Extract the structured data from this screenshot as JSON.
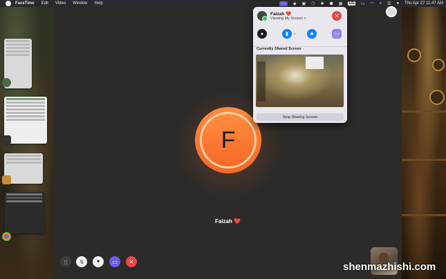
{
  "menubar": {
    "apple": "",
    "items": [
      "FaceTime",
      "Edit",
      "Video",
      "Window",
      "Help"
    ],
    "status_badge": "US",
    "clock": "Thu Apr 27  11:47 AM"
  },
  "call": {
    "avatar_initial": "F",
    "caller_name": "Faizah ❤️"
  },
  "popover": {
    "name": "Faizah ❤️",
    "subtitle": "Viewing My Screen >",
    "shared_label": "Currently Shared Screen",
    "stop_label": "Stop Sharing Screen",
    "close_glyph": "✕"
  },
  "controls": {
    "sidebar_glyph": "▯",
    "mic_glyph": "🎙",
    "video_glyph": "■",
    "share_glyph": "▭",
    "end_glyph": "✕"
  },
  "watermark": "shenmazhishi.com",
  "colors": {
    "accent": "#0a84ff",
    "share": "#6c5ce7",
    "end": "#ef4444",
    "avatar": "#f47a30"
  }
}
